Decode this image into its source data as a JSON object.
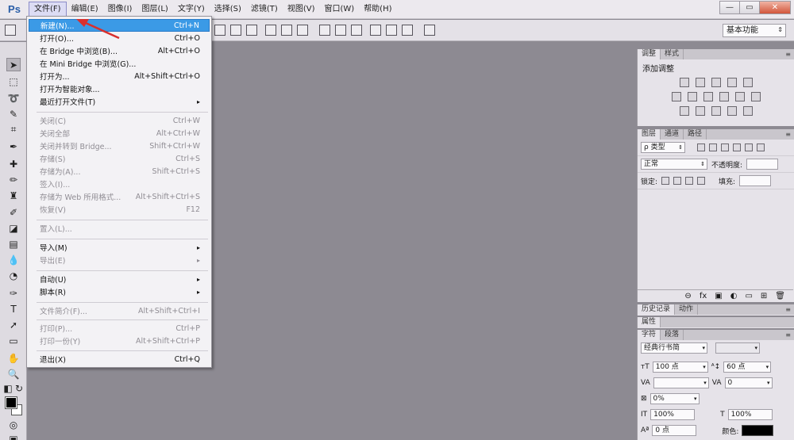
{
  "app": {
    "logo": "Ps"
  },
  "menubar": {
    "items": [
      "文件(F)",
      "编辑(E)",
      "图像(I)",
      "图层(L)",
      "文字(Y)",
      "选择(S)",
      "滤镜(T)",
      "视图(V)",
      "窗口(W)",
      "帮助(H)"
    ],
    "active_index": 0
  },
  "window_controls": {
    "minimize": "—",
    "maximize": "▭",
    "close": "✕"
  },
  "optionsbar": {
    "workspace": "基本功能"
  },
  "file_menu": {
    "items": [
      {
        "label": "新建(N)...",
        "shortcut": "Ctrl+N",
        "state": "highlighted"
      },
      {
        "label": "打开(O)...",
        "shortcut": "Ctrl+O",
        "state": "enabled"
      },
      {
        "label": "在 Bridge 中浏览(B)...",
        "shortcut": "Alt+Ctrl+O",
        "state": "enabled"
      },
      {
        "label": "在 Mini Bridge 中浏览(G)...",
        "shortcut": "",
        "state": "enabled"
      },
      {
        "label": "打开为...",
        "shortcut": "Alt+Shift+Ctrl+O",
        "state": "enabled"
      },
      {
        "label": "打开为智能对象...",
        "shortcut": "",
        "state": "enabled"
      },
      {
        "label": "最近打开文件(T)",
        "shortcut": "▸",
        "state": "enabled"
      },
      {
        "label": "关闭(C)",
        "shortcut": "Ctrl+W",
        "state": "disabled"
      },
      {
        "label": "关闭全部",
        "shortcut": "Alt+Ctrl+W",
        "state": "disabled"
      },
      {
        "label": "关闭并转到 Bridge...",
        "shortcut": "Shift+Ctrl+W",
        "state": "disabled"
      },
      {
        "label": "存储(S)",
        "shortcut": "Ctrl+S",
        "state": "disabled"
      },
      {
        "label": "存储为(A)...",
        "shortcut": "Shift+Ctrl+S",
        "state": "disabled"
      },
      {
        "label": "签入(I)...",
        "shortcut": "",
        "state": "disabled"
      },
      {
        "label": "存储为 Web 所用格式...",
        "shortcut": "Alt+Shift+Ctrl+S",
        "state": "disabled"
      },
      {
        "label": "恢复(V)",
        "shortcut": "F12",
        "state": "disabled"
      },
      {
        "label": "置入(L)...",
        "shortcut": "",
        "state": "disabled"
      },
      {
        "label": "导入(M)",
        "shortcut": "▸",
        "state": "enabled"
      },
      {
        "label": "导出(E)",
        "shortcut": "▸",
        "state": "disabled"
      },
      {
        "label": "自动(U)",
        "shortcut": "▸",
        "state": "enabled"
      },
      {
        "label": "脚本(R)",
        "shortcut": "▸",
        "state": "enabled"
      },
      {
        "label": "文件简介(F)...",
        "shortcut": "Alt+Shift+Ctrl+I",
        "state": "disabled"
      },
      {
        "label": "打印(P)...",
        "shortcut": "Ctrl+P",
        "state": "disabled"
      },
      {
        "label": "打印一份(Y)",
        "shortcut": "Alt+Shift+Ctrl+P",
        "state": "disabled"
      },
      {
        "label": "退出(X)",
        "shortcut": "Ctrl+Q",
        "state": "enabled"
      }
    ]
  },
  "adjust_panel": {
    "tabs": [
      "调整",
      "样式"
    ],
    "title": "添加调整"
  },
  "layers_panel": {
    "tabs": [
      "图层",
      "通道",
      "路径"
    ],
    "filter_label": "ρ 类型",
    "blend_mode": "正常",
    "opacity_label": "不透明度:",
    "lock_label": "锁定:",
    "fill_label": "填充:",
    "footer_glyphs": [
      "⊖",
      "fx",
      "▣",
      "◐",
      "▭",
      "⊞",
      "🗑"
    ]
  },
  "history_panel": {
    "tabs": [
      "历史记录",
      "动作"
    ]
  },
  "properties_panel": {
    "tabs": [
      "属性"
    ]
  },
  "character_panel": {
    "tabs": [
      "字符",
      "段落"
    ],
    "font": "经典行书简",
    "size": "100 点",
    "leading": "60 点",
    "tracking": "0",
    "scale_label": "0%",
    "vscale": "100%",
    "hscale": "100%",
    "baseline": "0 点",
    "color_label": "颜色:"
  }
}
